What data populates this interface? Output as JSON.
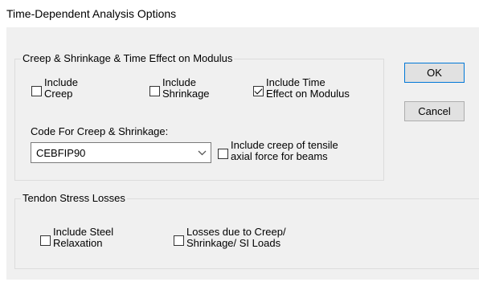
{
  "window": {
    "title": "Time-Dependent Analysis Options"
  },
  "creep_group": {
    "label": "Creep & Shrinkage & Time Effect on Modulus",
    "include_creep": {
      "lines": [
        "Include",
        "Creep"
      ],
      "checked": false
    },
    "include_shrinkage": {
      "lines": [
        "Include",
        "Shrinkage"
      ],
      "checked": false
    },
    "include_time_effect": {
      "lines": [
        "Include Time",
        "Effect on Modulus"
      ],
      "checked": true
    },
    "code_label": "Code For Creep & Shrinkage:",
    "code_select": {
      "value": "CEBFIP90"
    },
    "include_tensile": {
      "lines": [
        "Include creep of tensile",
        "axial force for beams"
      ],
      "checked": false
    }
  },
  "tendon_group": {
    "label": "Tendon Stress Losses",
    "include_relaxation": {
      "lines": [
        "Include Steel",
        "Relaxation"
      ],
      "checked": false
    },
    "losses_creep": {
      "lines": [
        "Losses due to Creep/",
        "Shrinkage/ SI Loads"
      ],
      "checked": false
    }
  },
  "buttons": {
    "ok": "OK",
    "cancel": "Cancel"
  }
}
